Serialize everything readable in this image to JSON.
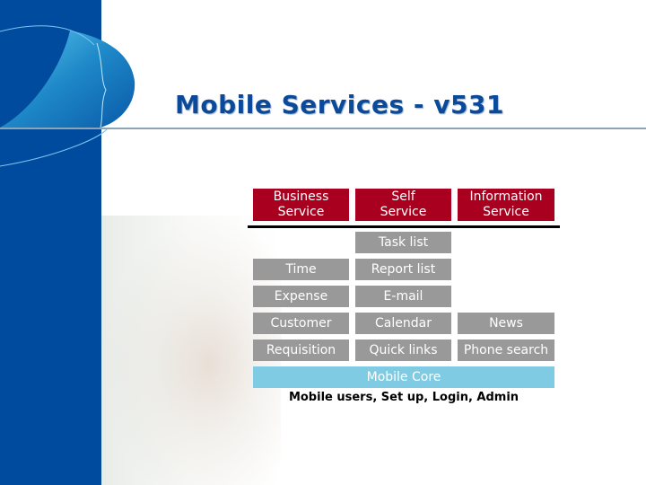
{
  "title": "Mobile Services - v531",
  "colors": {
    "brand_blue": "#004b9e",
    "title_blue": "#0b4a9b",
    "service_red": "#a8001e",
    "module_gray": "#999999",
    "core_cyan": "#7ecbe3"
  },
  "categories": [
    {
      "label": "Business Service"
    },
    {
      "label": "Self Service"
    },
    {
      "label": "Information Service"
    }
  ],
  "modules": {
    "business": [
      "Time",
      "Expense",
      "Customer",
      "Requisition"
    ],
    "self": [
      "Task list",
      "Report list",
      "E-mail",
      "Calendar",
      "Quick links"
    ],
    "information": [
      "News",
      "Phone search"
    ]
  },
  "core": {
    "label": "Mobile Core",
    "description": "Mobile users, Set up, Login, Admin"
  }
}
